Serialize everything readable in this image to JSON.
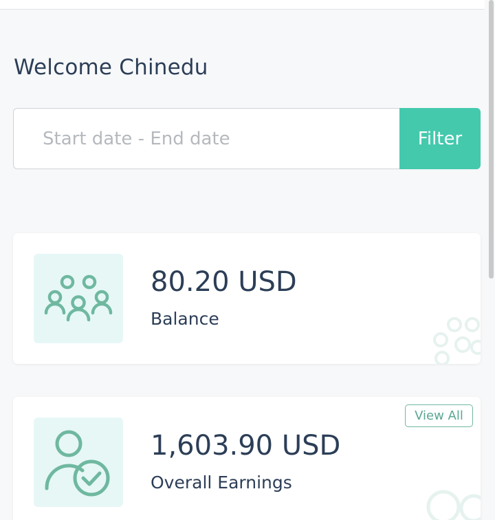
{
  "header": {
    "welcome_text": "Welcome Chinedu"
  },
  "filter": {
    "date_range_placeholder": "Start date - End date",
    "date_range_value": "",
    "filter_label": "Filter"
  },
  "cards": {
    "balance": {
      "amount": "80.20 USD",
      "label": "Balance",
      "icon": "users-group-icon"
    },
    "earnings": {
      "amount": "1,603.90 USD",
      "label": "Overall Earnings",
      "view_all_label": "View All",
      "icon": "user-check-icon"
    }
  },
  "colors": {
    "accent": "#44c9ad",
    "icon_color": "#6fb8a0",
    "icon_tile_bg": "#e6f7f6",
    "text_primary": "#2c3e57",
    "placeholder": "#b5b9be"
  }
}
